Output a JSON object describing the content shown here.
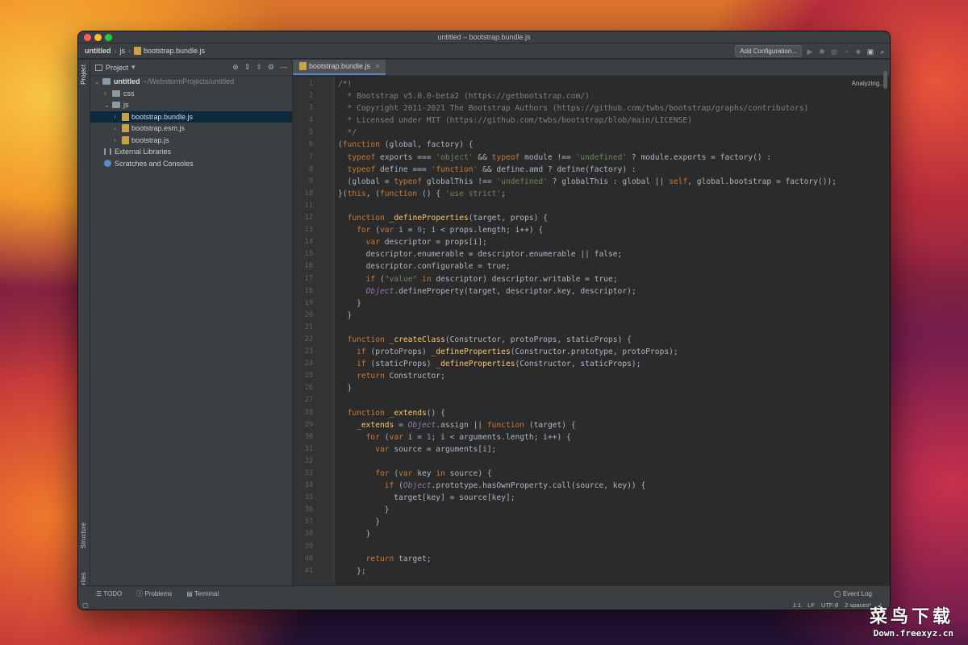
{
  "window": {
    "title": "untitled – bootstrap.bundle.js"
  },
  "breadcrumb": {
    "project": "untitled",
    "folder": "js",
    "file": "bootstrap.bundle.js"
  },
  "toolbar": {
    "add_config": "Add Configuration..."
  },
  "sidebar": {
    "project_label": "Project",
    "vtabs": {
      "project": "Project",
      "structure": "Structure",
      "favorites": "Favorites"
    }
  },
  "tree": {
    "root": "untitled",
    "root_path": "~/WebstormProjects/untitled",
    "css": "css",
    "js": "js",
    "files": [
      "bootstrap.bundle.js",
      "bootstrap.esm.js",
      "bootstrap.js"
    ],
    "external": "External Libraries",
    "scratches": "Scratches and Consoles"
  },
  "editor": {
    "tab": "bootstrap.bundle.js",
    "analyzing": "Analyzing..."
  },
  "code": [
    "/*!",
    "  * Bootstrap v5.0.0-beta2 (https://getbootstrap.com/)",
    "  * Copyright 2011-2021 The Bootstrap Authors (https://github.com/twbs/bootstrap/graphs/contributors)",
    "  * Licensed under MIT (https://github.com/twbs/bootstrap/blob/main/LICENSE)",
    "  */",
    "(function (global, factory) {",
    "  typeof exports === 'object' && typeof module !== 'undefined' ? module.exports = factory() :",
    "  typeof define === 'function' && define.amd ? define(factory) :",
    "  (global = typeof globalThis !== 'undefined' ? globalThis : global || self, global.bootstrap = factory());",
    "}(this, (function () { 'use strict';",
    "",
    "  function _defineProperties(target, props) {",
    "    for (var i = 0; i < props.length; i++) {",
    "      var descriptor = props[i];",
    "      descriptor.enumerable = descriptor.enumerable || false;",
    "      descriptor.configurable = true;",
    "      if (\"value\" in descriptor) descriptor.writable = true;",
    "      Object.defineProperty(target, descriptor.key, descriptor);",
    "    }",
    "  }",
    "",
    "  function _createClass(Constructor, protoProps, staticProps) {",
    "    if (protoProps) _defineProperties(Constructor.prototype, protoProps);",
    "    if (staticProps) _defineProperties(Constructor, staticProps);",
    "    return Constructor;",
    "  }",
    "",
    "  function _extends() {",
    "    _extends = Object.assign || function (target) {",
    "      for (var i = 1; i < arguments.length; i++) {",
    "        var source = arguments[i];",
    "",
    "        for (var key in source) {",
    "          if (Object.prototype.hasOwnProperty.call(source, key)) {",
    "            target[key] = source[key];",
    "          }",
    "        }",
    "      }",
    "",
    "      return target;",
    "    };"
  ],
  "bottom_tools": {
    "todo": "TODO",
    "problems": "Problems",
    "terminal": "Terminal",
    "event_log": "Event Log"
  },
  "status": {
    "position": "1:1",
    "line_sep": "LF",
    "encoding": "UTF-8",
    "indent": "2 spaces*"
  },
  "watermark": {
    "title": "菜鸟下载",
    "url": "Down.freexyz.cn"
  }
}
